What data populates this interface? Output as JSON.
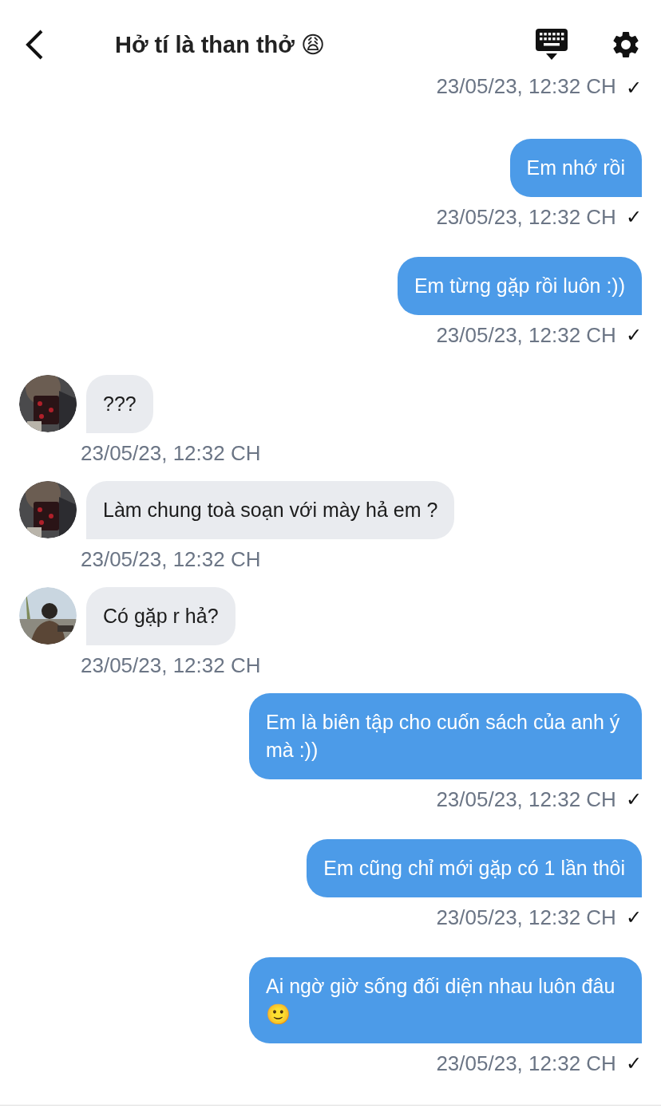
{
  "header": {
    "title": "Hở tí là than thở 😩"
  },
  "cut_timestamp": {
    "time": "23/05/23, 12:32 CH",
    "check": "✓"
  },
  "messages": [
    {
      "kind": "sent",
      "text": "Em nhớ rồi",
      "time": "23/05/23, 12:32 CH",
      "check": "✓"
    },
    {
      "kind": "sent",
      "text": "Em từng gặp rồi luôn :))",
      "time": "23/05/23, 12:32 CH",
      "check": "✓"
    },
    {
      "kind": "received",
      "text": "???",
      "time": "23/05/23, 12:32 CH"
    },
    {
      "kind": "received",
      "text": "Làm chung toà soạn với mày hả em ?",
      "time": "23/05/23, 12:32 CH"
    },
    {
      "kind": "received",
      "text": "Có gặp r hả?",
      "time": "23/05/23, 12:32 CH"
    },
    {
      "kind": "sent",
      "text": "Em là biên tập cho cuốn sách của anh ý mà :))",
      "time": "23/05/23, 12:32 CH",
      "check": "✓"
    },
    {
      "kind": "sent",
      "text": "Em cũng chỉ mới gặp có 1 lần thôi",
      "time": "23/05/23, 12:32 CH",
      "check": "✓"
    },
    {
      "kind": "sent",
      "text": "Ai ngờ giờ sống đối diện nhau luôn đâu 🙂",
      "time": "23/05/23, 12:32 CH",
      "check": "✓"
    }
  ]
}
